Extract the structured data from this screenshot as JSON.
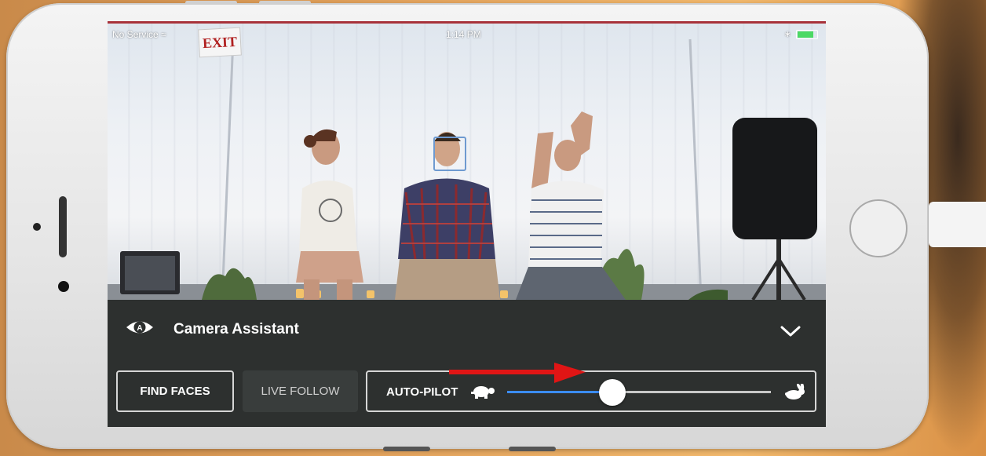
{
  "status_bar": {
    "carrier": "No Service",
    "time": "1:14 PM",
    "battery_level": 0.84
  },
  "scene": {
    "exit_sign": "EXIT"
  },
  "camera_assistant": {
    "title": "Camera Assistant",
    "buttons": {
      "find_faces": "FIND FACES",
      "live_follow": "LIVE FOLLOW"
    },
    "autopilot": {
      "label": "AUTO-PILOT",
      "speed_fraction": 0.4
    }
  },
  "colors": {
    "panel_background": "#2d302f",
    "slider_fill": "#3b8cff",
    "annotation_arrow": "#e01515"
  },
  "icons": {
    "view": "eye-icon",
    "collapse": "chevron-down-icon",
    "slow": "turtle-icon",
    "fast": "rabbit-icon",
    "wifi": "wifi-icon",
    "bluetooth": "bluetooth-icon"
  }
}
